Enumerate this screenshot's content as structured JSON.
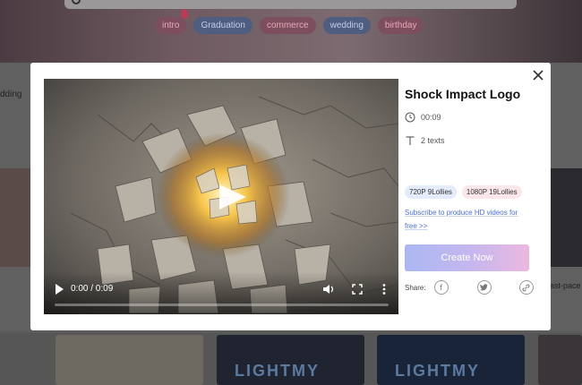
{
  "background": {
    "tags": [
      {
        "label": "intro",
        "tone": "pink"
      },
      {
        "label": "Graduation",
        "tone": "blue"
      },
      {
        "label": "commerce",
        "tone": "pink"
      },
      {
        "label": "wedding",
        "tone": "blue"
      },
      {
        "label": "birthday",
        "tone": "pink"
      }
    ],
    "left_snippet": "dding",
    "right_snippet": "ast-pace",
    "thumb_snippet_1": "LIGHTMY",
    "thumb_snippet_2": "LIGHTMY"
  },
  "modal": {
    "close_icon": "close-icon",
    "video": {
      "time_display": "0:00 / 0:09",
      "progress": 0
    },
    "title": "Shock Impact Logo",
    "duration": "00:09",
    "texts_count": "2 texts",
    "prices": {
      "p720": "720P 9Lollies",
      "p1080": "1080P 19Lollies"
    },
    "subscribe_link": "Subscribe to produce HD videos for free >>",
    "create_button": "Create Now",
    "share_label": "Share:",
    "colors": {
      "accent_start": "#aab8f2",
      "accent_end": "#ebb8de",
      "link": "#4b6ee0"
    }
  }
}
